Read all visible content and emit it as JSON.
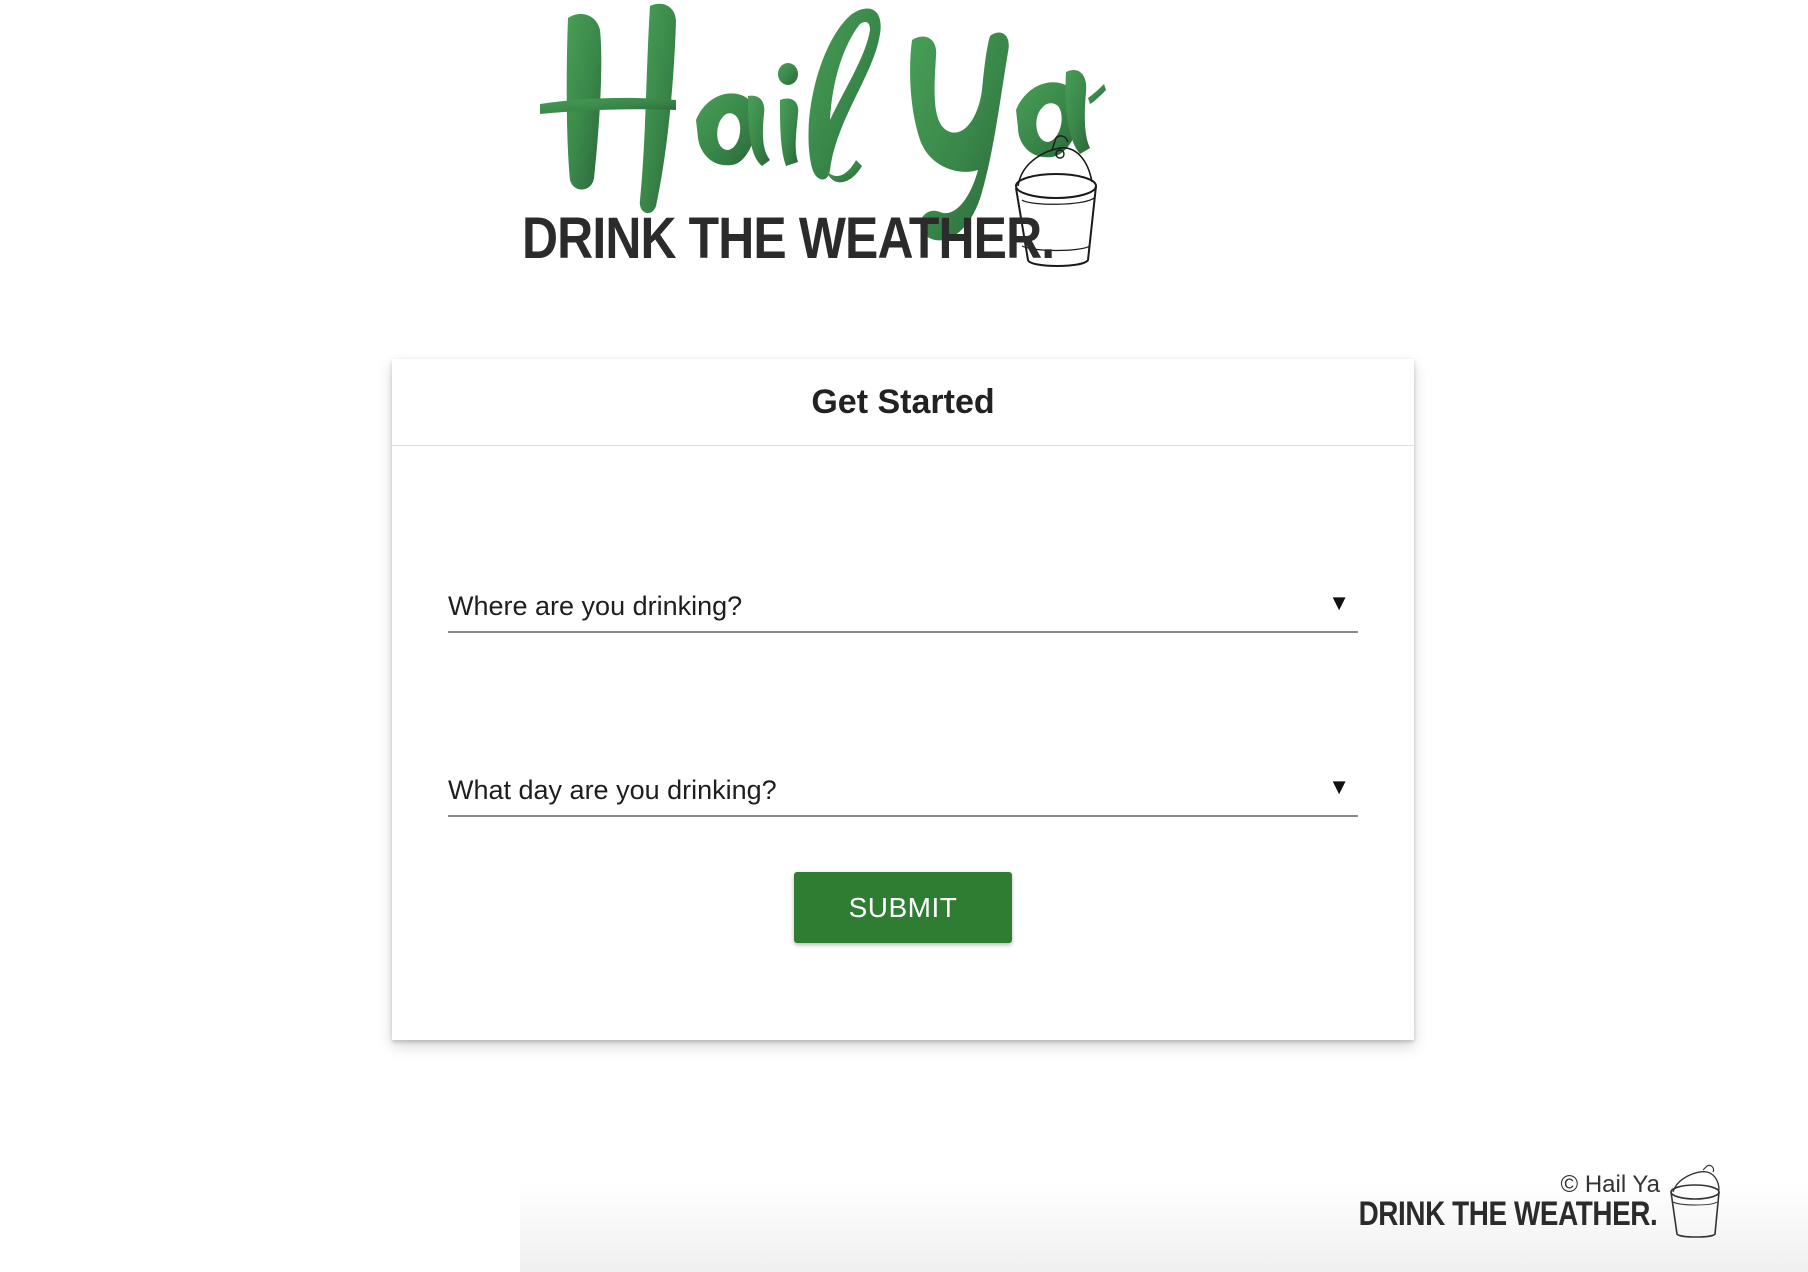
{
  "brand": {
    "script_name": "Hail Ya",
    "tagline": "DRINK THE WEATHER.",
    "accent_color": "#2e7d32",
    "logo_icon": "bucket-icon"
  },
  "form": {
    "title": "Get Started",
    "location_label": "Where are you drinking?",
    "day_label": "What day are you drinking?",
    "dropdown_icon": "triangle-down-icon",
    "submit_label": "SUBMIT"
  },
  "footer": {
    "copyright": "© Hail Ya",
    "tagline": "DRINK THE WEATHER.",
    "logo_icon": "bucket-icon"
  }
}
